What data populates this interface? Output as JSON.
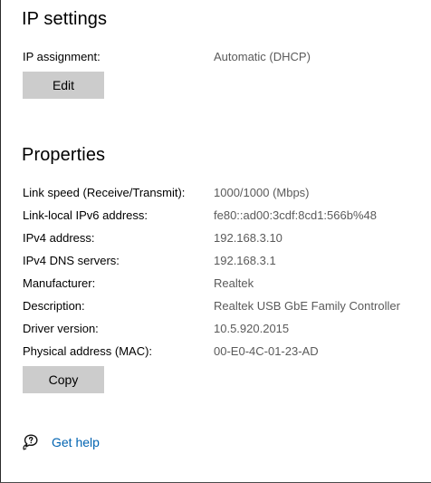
{
  "ip_settings": {
    "title": "IP settings",
    "assignment_label": "IP assignment:",
    "assignment_value": "Automatic (DHCP)",
    "edit_label": "Edit"
  },
  "properties": {
    "title": "Properties",
    "rows": [
      {
        "label": "Link speed (Receive/Transmit):",
        "value": "1000/1000 (Mbps)"
      },
      {
        "label": "Link-local IPv6 address:",
        "value": "fe80::ad00:3cdf:8cd1:566b%48"
      },
      {
        "label": "IPv4 address:",
        "value": "192.168.3.10"
      },
      {
        "label": "IPv4 DNS servers:",
        "value": "192.168.3.1"
      },
      {
        "label": "Manufacturer:",
        "value": "Realtek"
      },
      {
        "label": "Description:",
        "value": "Realtek USB GbE Family Controller"
      },
      {
        "label": "Driver version:",
        "value": "10.5.920.2015"
      },
      {
        "label": "Physical address (MAC):",
        "value": "00-E0-4C-01-23-AD"
      }
    ],
    "copy_label": "Copy"
  },
  "help": {
    "icon": "chat-help-icon",
    "label": "Get help"
  },
  "colors": {
    "link": "#0063b1",
    "button_bg": "#cccccc",
    "value_text": "#5a5a5a"
  }
}
